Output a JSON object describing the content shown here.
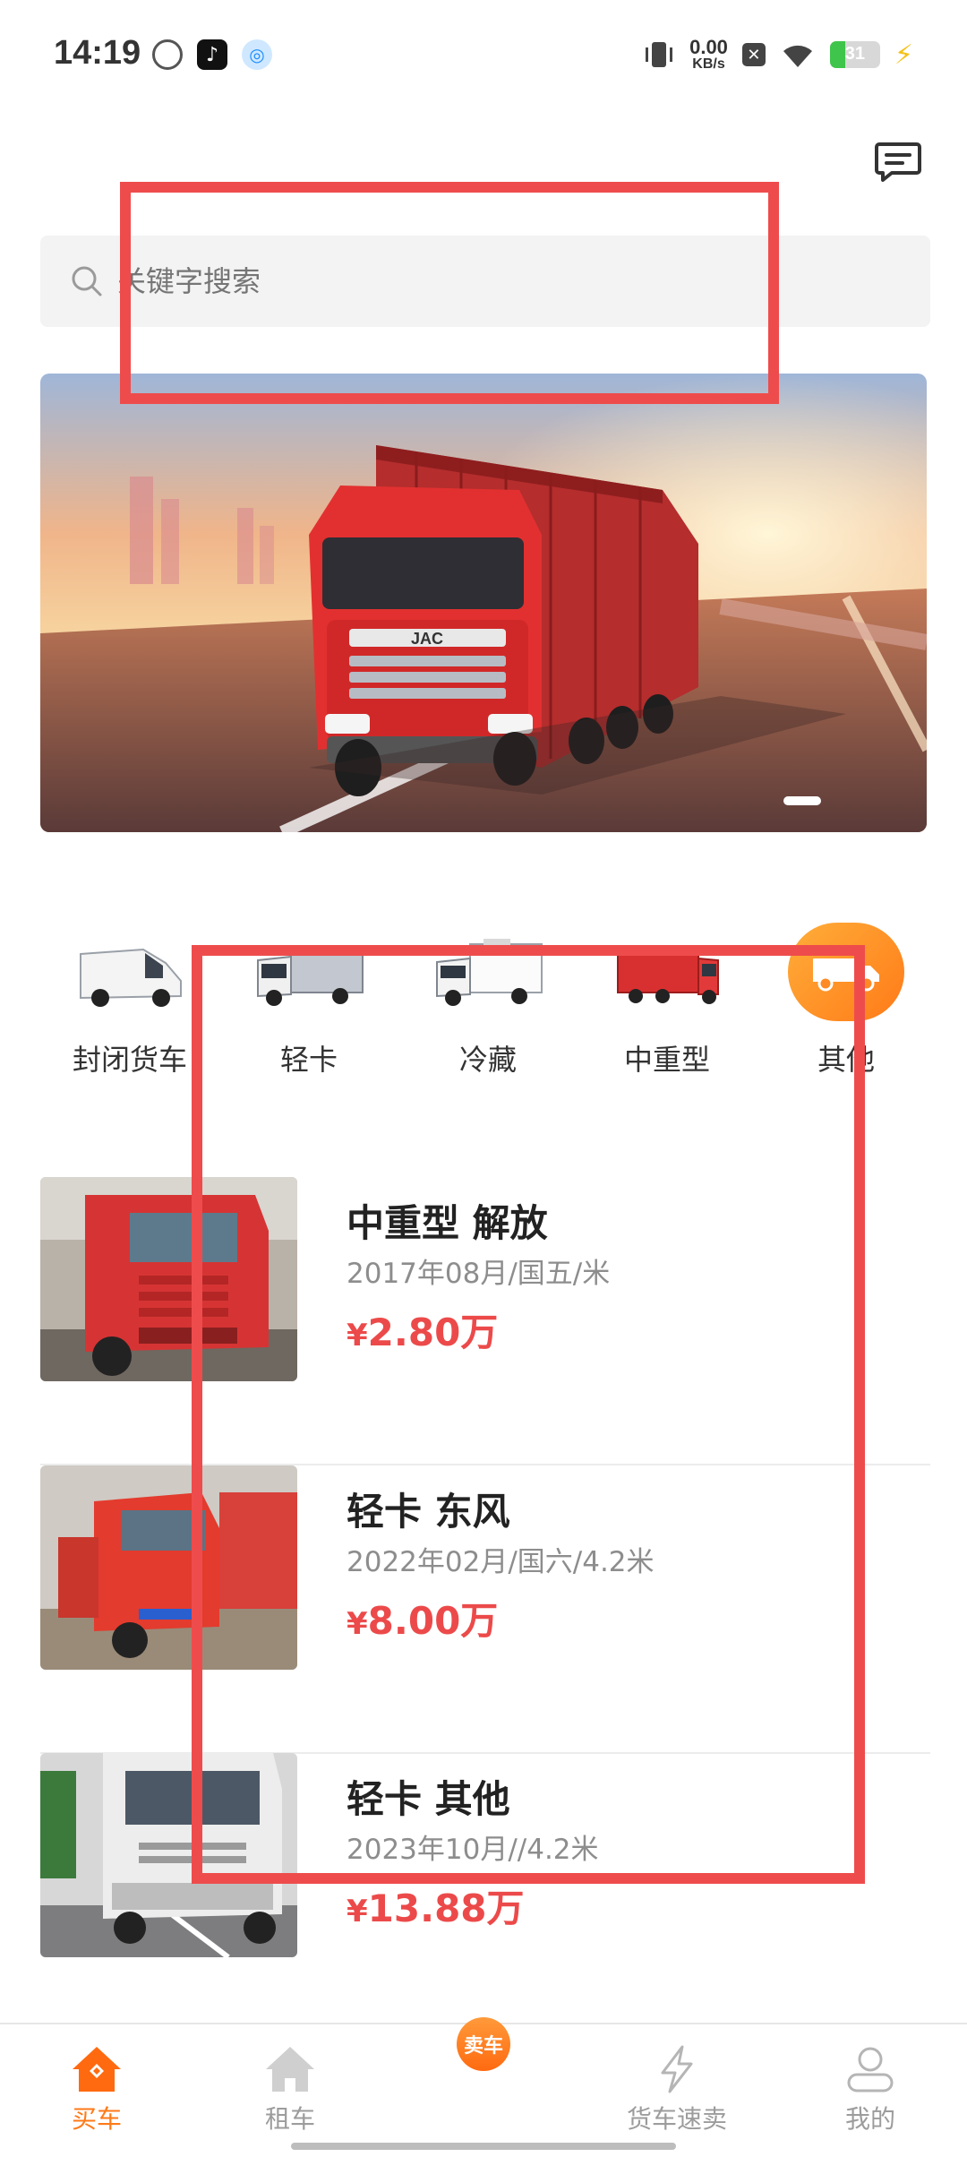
{
  "status_bar": {
    "time": "14:19",
    "net_speed_value": "0.00",
    "net_speed_unit": "KB/s",
    "battery": "31",
    "battery_level": 0.31
  },
  "search": {
    "placeholder": "关键字搜索"
  },
  "categories": [
    {
      "label": "封闭货车",
      "icon": "van-icon"
    },
    {
      "label": "轻卡",
      "icon": "light-truck-icon"
    },
    {
      "label": "冷藏",
      "icon": "refrigerated-truck-icon"
    },
    {
      "label": "中重型",
      "icon": "heavy-truck-icon"
    },
    {
      "label": "其他",
      "icon": "other-truck-icon"
    }
  ],
  "listings": [
    {
      "title": "中重型 解放",
      "meta": "2017年08月/国五/米",
      "currency": "¥",
      "price": "2.80万"
    },
    {
      "title": "轻卡 东风",
      "meta": "2022年02月/国六/4.2米",
      "currency": "¥",
      "price": "8.00万"
    },
    {
      "title": "轻卡 其他",
      "meta": "2023年10月//4.2米",
      "currency": "¥",
      "price": "13.88万"
    }
  ],
  "tabs": [
    {
      "label": "买车",
      "icon": "home-icon",
      "active": true
    },
    {
      "label": "租车",
      "icon": "house-icon",
      "active": false
    },
    {
      "label": "卖车",
      "icon": "sell-badge",
      "active": false
    },
    {
      "label": "货车速卖",
      "icon": "lightning-icon",
      "active": false
    },
    {
      "label": "我的",
      "icon": "profile-icon",
      "active": false
    }
  ],
  "colors": {
    "accent": "#ff7a18",
    "price": "#ec4a4a",
    "annotation": "#ee4c4c"
  }
}
